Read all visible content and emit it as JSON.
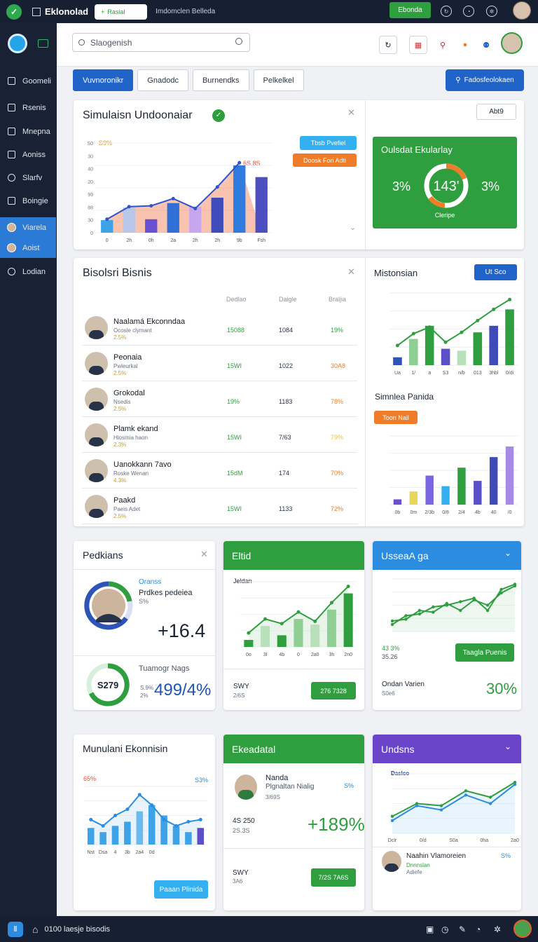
{
  "topbar": {
    "app_title": "Eklonolad",
    "tab_label": "Rasial",
    "subtitle": "Imdomclen Belleda",
    "action_button": "Ebonda"
  },
  "sidebar": {
    "items": [
      {
        "label": "Goomeli",
        "icon": "square-icon"
      },
      {
        "label": "Rsenis",
        "icon": "pen-icon"
      },
      {
        "label": "Mnepna",
        "icon": "card-icon"
      },
      {
        "label": "Aoniss",
        "icon": "wrench-icon"
      },
      {
        "label": "Slarfv",
        "icon": "circle-icon"
      },
      {
        "label": "Boingie",
        "icon": "grid-icon"
      },
      {
        "label": "Viarela",
        "icon": "avatar-icon"
      },
      {
        "label": "Aoist",
        "icon": "avatar-icon"
      },
      {
        "label": "Lodian",
        "icon": "clock-icon"
      }
    ]
  },
  "header": {
    "search_placeholder": "Slaogenish"
  },
  "tabs": [
    "Vuvnoronikr",
    "Gnadodc",
    "Burnendks",
    "Pelkelkel"
  ],
  "cta": "Fadosfeolokaen",
  "simulation": {
    "title": "Simulaisn Undoonaiar",
    "badge_a": "Tbsb Pvefiel",
    "badge_b": "Doosk Fori Adti",
    "annotation": "6S.8S",
    "percent_label": "S9%",
    "side_button": "Abt9",
    "status_card": {
      "title": "Oulsdat Ekularlay",
      "left": "3%",
      "center": "143'",
      "right": "3%",
      "caption": "Cleripe"
    }
  },
  "bisnis": {
    "title": "Bisolsri Bisnis",
    "columns": [
      "Dedlao",
      "Daigle",
      "Braljia"
    ],
    "rows": [
      {
        "name": "Naalamá Ekconndaa",
        "sub": "Ocosle clymant",
        "pct": "2.5%",
        "c1": "15088",
        "c2": "1084",
        "c3": "19%",
        "c3color": "#2f9e3f"
      },
      {
        "name": "Peonaia",
        "sub": "Pwleurkal",
        "pct": "2.5%",
        "c1": "15WI",
        "c2": "1022",
        "c3": "30A8",
        "c3color": "#ef7c28"
      },
      {
        "name": "Grokodal",
        "sub": "Nsedis",
        "pct": "2.5%",
        "c1": "19%",
        "c2": "1183",
        "c3": "78%",
        "c3color": "#ef7c28"
      },
      {
        "name": "Plamk ekand",
        "sub": "Hiosmia haon",
        "pct": "2.3%",
        "c1": "15WI",
        "c2": "7/63",
        "c3": "79%",
        "c3color": "#e8c43c"
      },
      {
        "name": "Uanokkann 7avo",
        "sub": "Roske Wenan",
        "pct": "4.3%",
        "c1": "15dM",
        "c2": "174",
        "c3": "70%",
        "c3color": "#ef7c28"
      },
      {
        "name": "Paakd",
        "sub": "Paeis Adet",
        "pct": "2.5%",
        "c1": "15WI",
        "c2": "1133",
        "c3": "72%",
        "c3color": "#ef7c28"
      }
    ]
  },
  "mistonsian": {
    "title": "Mistonsian",
    "button": "Ut Sco"
  },
  "simnlea": {
    "title": "Simnlea Panida",
    "button": "Toon Nail"
  },
  "pedkians": {
    "title": "Pedkians",
    "label1": "Oranss",
    "label2": "Prdkes pedeiea",
    "label3": "S%",
    "value": "+16.4",
    "ring_value": "S279",
    "label4": "Tuamogr Nags",
    "label5": "S.9%",
    "label6": "2%",
    "value2": "499/4%"
  },
  "eltid": {
    "title": "Eltid",
    "sub": "Jeldan",
    "foot1": "SWY",
    "foot2": "2/6S",
    "button": "276 7328"
  },
  "usseag": {
    "title": "UsseaA ga",
    "l1": "43 3%",
    "l2": "35.26",
    "button": "Taagla Puenis",
    "l3": "Ondan Varien",
    "l4": "S0e6",
    "value": "30%"
  },
  "munulani": {
    "title": "Munulani Ekonnisin",
    "left": "65%",
    "right": "S3%",
    "button": "Paaan Plinida"
  },
  "ekeadatal": {
    "title": "Ekeadatal",
    "name": "Nanda",
    "sub": "Plgnaltan Nialig",
    "sub2": "3/69S",
    "pct": "S%",
    "l1": "4S 250",
    "l2": "2S.3S",
    "value": "+189%",
    "f1": "SWY",
    "f2": "3A6",
    "button": "7/2S 7A6S"
  },
  "undsns": {
    "title": "Undsns",
    "legend": "Daslco",
    "name": "Naahin Vlamoreien",
    "sub": "Dnnnslan",
    "sub2": "Adiefe",
    "pct": "S%"
  },
  "bottombar": {
    "text": "0100 laesje bisodis"
  },
  "chart_data": [
    {
      "type": "bar",
      "title": "Simulaisn Undoonaiar",
      "categories": [
        "0",
        "2h",
        "0h",
        "2a",
        "2h",
        "2h",
        "9b",
        "Fsh"
      ],
      "series": [
        {
          "name": "bars",
          "values": [
            140,
            280,
            150,
            330,
            290,
            390,
            750,
            620
          ]
        },
        {
          "name": "line",
          "values": [
            150,
            290,
            300,
            380,
            270,
            510,
            780,
            0
          ]
        }
      ],
      "ylim": [
        0,
        1000
      ],
      "yticks": [
        "0",
        "30",
        "88",
        "99",
        "20",
        "40",
        "30",
        "S0"
      ]
    },
    {
      "type": "bar",
      "title": "Mistonsian",
      "categories": [
        "Ua",
        "1/",
        "a",
        "S3",
        "n/b",
        "013",
        "3hbl",
        "0/di"
      ],
      "series": [
        {
          "name": "bars",
          "values": [
            12,
            40,
            60,
            25,
            22,
            50,
            60,
            85
          ]
        },
        {
          "name": "line",
          "values": [
            30,
            48,
            58,
            35,
            50,
            68,
            85,
            100
          ]
        }
      ],
      "ylim": [
        0,
        110
      ]
    },
    {
      "type": "bar",
      "title": "Simnlea Panida",
      "categories": [
        "0b",
        "0m",
        "2/3b",
        "0/8",
        "2/4",
        "4b",
        "40",
        "/0"
      ],
      "series": [
        {
          "name": "bars",
          "values": [
            10,
            25,
            55,
            35,
            70,
            45,
            90,
            110
          ]
        }
      ],
      "ylim": [
        0,
        130
      ]
    },
    {
      "type": "line",
      "title": "Eltid",
      "categories": [
        "0o",
        "3l",
        "4b",
        "0",
        "2a0",
        "3h",
        "2n0"
      ],
      "series": [
        {
          "name": "bars",
          "values": [
            15,
            45,
            25,
            60,
            48,
            80,
            115
          ]
        },
        {
          "name": "line",
          "values": [
            30,
            60,
            50,
            75,
            55,
            95,
            130
          ]
        }
      ],
      "ylim": [
        0,
        140
      ]
    },
    {
      "type": "line",
      "title": "UsseaA ga",
      "series": [
        {
          "name": "a",
          "values": [
            20,
            45,
            50,
            70,
            75,
            85,
            95,
            60,
            120,
            135
          ]
        },
        {
          "name": "b",
          "values": [
            30,
            35,
            60,
            55,
            80,
            60,
            90,
            75,
            110,
            130
          ]
        }
      ],
      "ylim": [
        0,
        150
      ]
    },
    {
      "type": "bar",
      "title": "Munulani Ekonnisin",
      "categories": [
        "Nst",
        "Dsa",
        "4",
        "3b",
        "2a4",
        "0d"
      ],
      "series": [
        {
          "name": "bars",
          "values": [
            40,
            30,
            45,
            55,
            80,
            95,
            70,
            45,
            30,
            40
          ]
        },
        {
          "name": "line",
          "values": [
            60,
            45,
            70,
            85,
            120,
            95,
            60,
            45,
            55,
            60
          ]
        }
      ],
      "ylim": [
        0,
        140
      ]
    },
    {
      "type": "area",
      "title": "Undsns",
      "categories": [
        "Dclr",
        "0/d",
        "S0a",
        "0ha",
        "2a0"
      ],
      "series": [
        {
          "name": "Daslco",
          "values": [
            40,
            70,
            65,
            100,
            85,
            120
          ]
        },
        {
          "name": "b",
          "values": [
            30,
            65,
            55,
            90,
            70,
            115
          ]
        }
      ],
      "ylim": [
        0,
        140
      ]
    }
  ]
}
